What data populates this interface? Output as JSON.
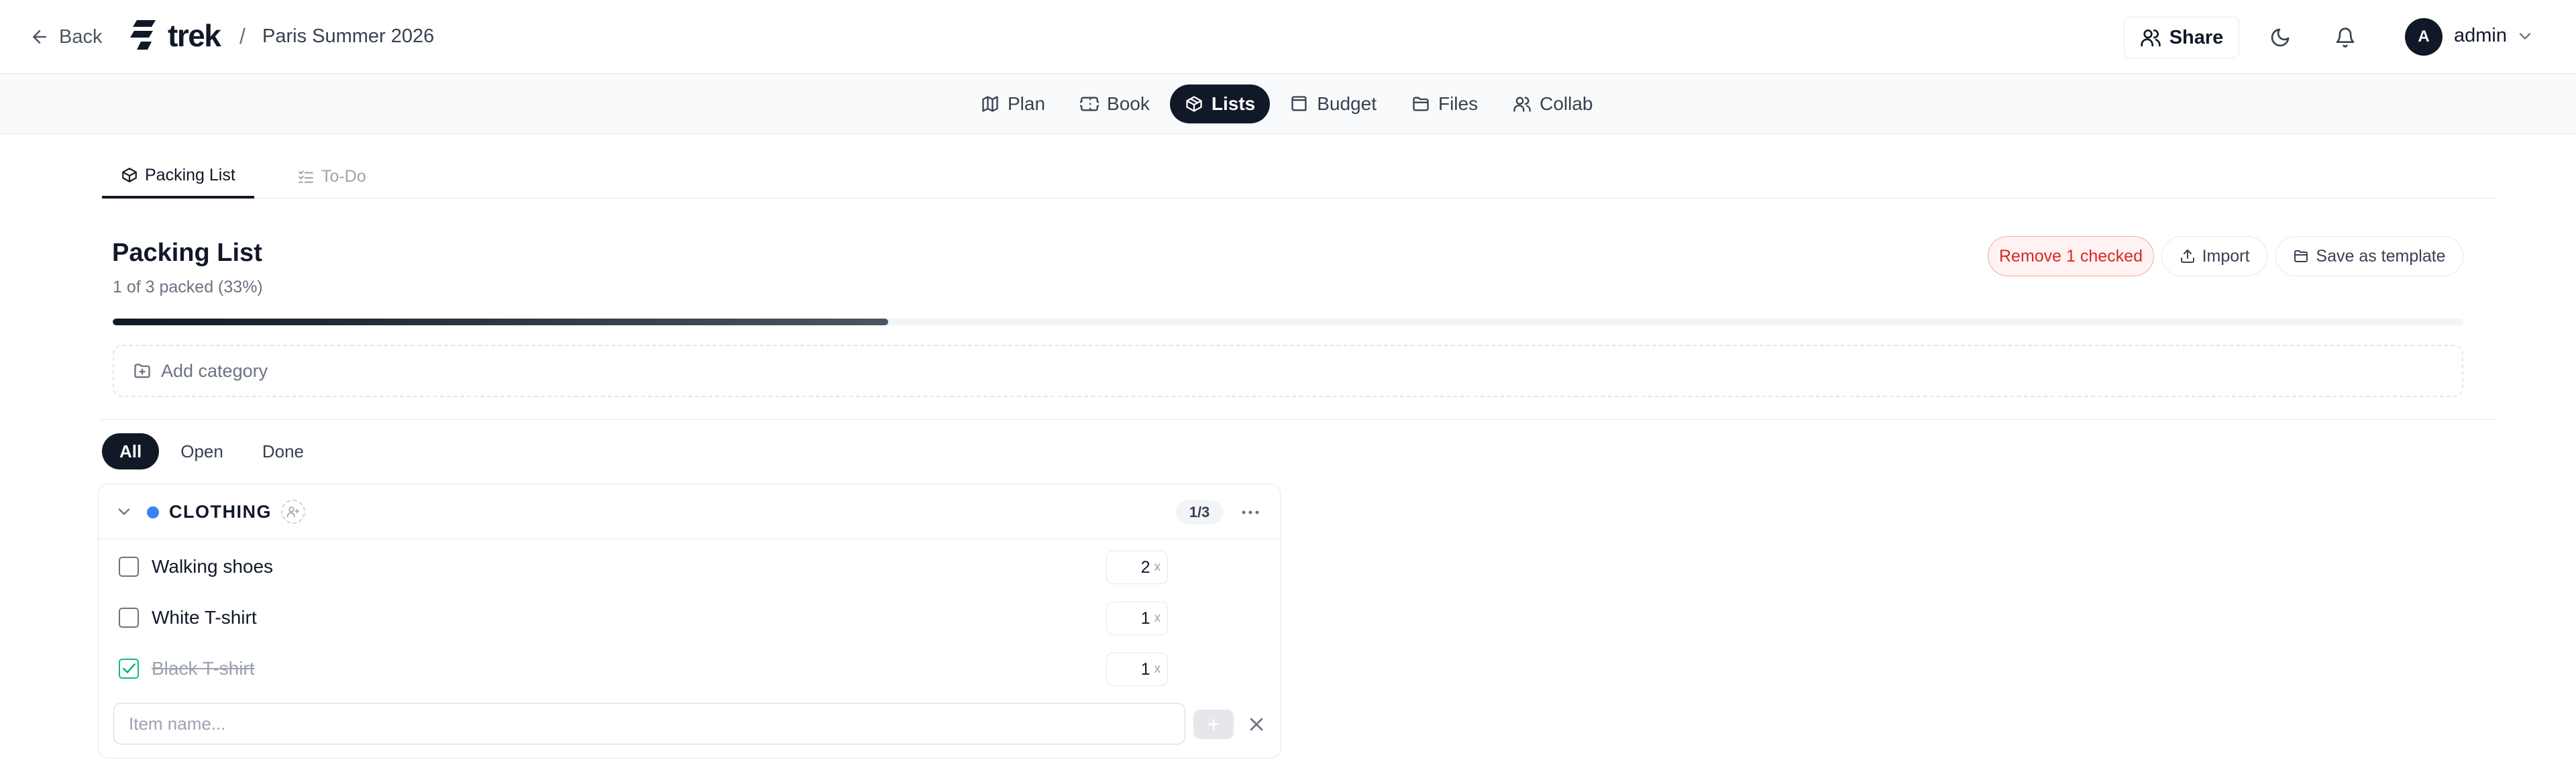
{
  "header": {
    "back_label": "Back",
    "logo_text": "trek",
    "separator": "/",
    "trip_name": "Paris Summer 2026",
    "share_label": "Share",
    "user_initial": "A",
    "user_name": "admin"
  },
  "nav": {
    "items": [
      {
        "label": "Plan",
        "icon": "map-icon",
        "active": false
      },
      {
        "label": "Book",
        "icon": "ticket-icon",
        "active": false
      },
      {
        "label": "Lists",
        "icon": "package-icon",
        "active": true
      },
      {
        "label": "Budget",
        "icon": "wallet-icon",
        "active": false
      },
      {
        "label": "Files",
        "icon": "folder-icon",
        "active": false
      },
      {
        "label": "Collab",
        "icon": "users-icon",
        "active": false
      }
    ]
  },
  "subtabs": {
    "packing_label": "Packing List",
    "todo_label": "To-Do"
  },
  "packing": {
    "title": "Packing List",
    "summary": "1 of 3 packed (33%)",
    "progress_fraction": 0.33,
    "remove_label": "Remove 1 checked",
    "import_label": "Import",
    "save_template_label": "Save as template",
    "add_category_label": "Add category"
  },
  "filters": [
    "All",
    "Open",
    "Done"
  ],
  "category": {
    "name": "CLOTHING",
    "color": "#3b82f6",
    "count": "1/3",
    "items": [
      {
        "name": "Walking shoes",
        "qty": "2",
        "unit": "x",
        "checked": false
      },
      {
        "name": "White T-shirt",
        "qty": "1",
        "unit": "x",
        "checked": false
      },
      {
        "name": "Black T-shirt",
        "qty": "1",
        "unit": "x",
        "checked": true
      }
    ],
    "new_item_placeholder": "Item name..."
  },
  "colors": {
    "accent": "#111827",
    "danger": "#dc2626",
    "success": "#10b981"
  }
}
